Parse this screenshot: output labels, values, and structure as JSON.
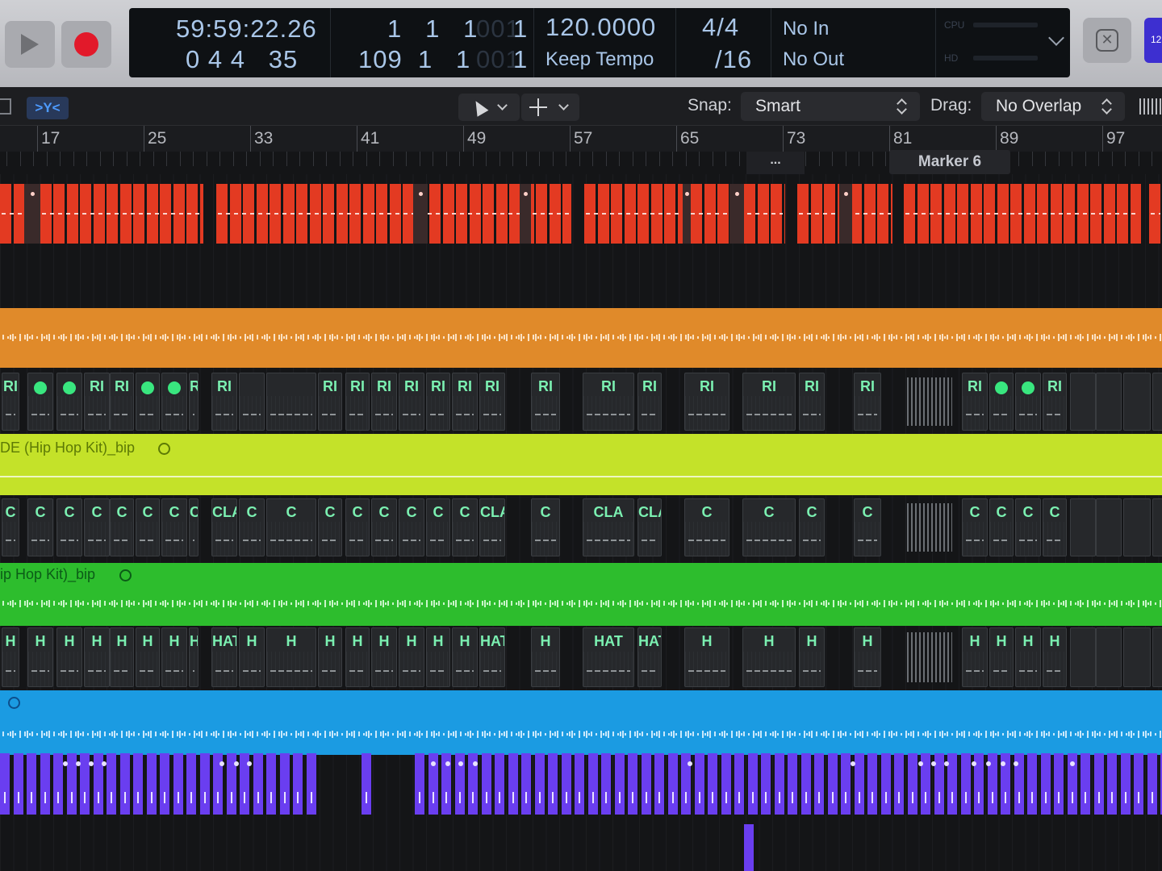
{
  "transport": {
    "timecode_top": "59:59:22.26",
    "timecode_bottom": "0 4 4   35",
    "bars_top": "1   1   1",
    "bars_top_ghost": "001",
    "bars_top_end": "1",
    "bars_bottom": "109  1   1",
    "bars_bottom_ghost": "001",
    "bars_bottom_end": "1",
    "tempo": "120.0000",
    "tempo_mode": "Keep Tempo",
    "signature": "4/4",
    "division": "/16",
    "midi_in": "No In",
    "midi_out": "No Out",
    "cpu_label": "CPU",
    "hd_label": "HD",
    "corner_text": "12"
  },
  "toolbar": {
    "catch_label": ">Y<",
    "snap_label": "Snap:",
    "snap_value": "Smart",
    "drag_label": "Drag:",
    "drag_value": "No Overlap"
  },
  "ruler": {
    "bars": [
      "17",
      "25",
      "33",
      "41",
      "49",
      "57",
      "65",
      "73",
      "81",
      "89",
      "97"
    ],
    "marker_dots": "...",
    "marker_name": "Marker 6"
  },
  "tracks": {
    "hihat_kit_label": "DE (Hip Hop Kit)_bip",
    "clap_kit_label": "ip Hop Kit)_bip",
    "ride_regions": [
      "RI",
      "",
      "",
      "RI",
      "RI",
      "",
      "",
      "RI",
      "RI",
      "",
      "",
      "RI",
      "RI",
      "RI",
      "RI",
      "RI",
      "RI",
      "RI",
      "RI",
      "RI",
      "RI",
      "RI",
      "RI",
      "RI",
      "RI",
      "RI",
      "",
      "",
      "RI"
    ],
    "clap_regions": [
      "C",
      "C",
      "C",
      "C",
      "C",
      "C",
      "C",
      "C",
      "CLAC",
      "C",
      "C",
      "C",
      "C",
      "C",
      "C",
      "C",
      "C",
      "CLAC",
      "C",
      "CLA",
      "CLAC",
      "C",
      "C",
      "C",
      "C",
      "C",
      "C",
      "C",
      "C"
    ],
    "hat_regions": [
      "H",
      "H",
      "H",
      "H",
      "H",
      "H",
      "H",
      "H",
      "HAT (",
      "H",
      "H",
      "H",
      "H",
      "H",
      "H",
      "H",
      "H",
      "HAT (",
      "H",
      "HAT",
      "HAT (",
      "H",
      "H",
      "H",
      "H",
      "H",
      "H",
      "H",
      "H"
    ]
  },
  "colors": {
    "red_track": "#e33a22",
    "orange_track": "#e08a2a",
    "ride_text": "#7bf0b1",
    "lime_track": "#c4e229",
    "green_track": "#2dbd2d",
    "blue_track": "#1b9be2",
    "purple_track": "#6a3ef0"
  }
}
